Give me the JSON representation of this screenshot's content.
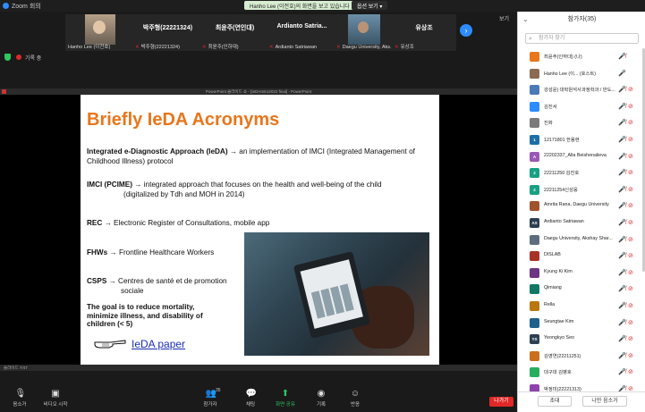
{
  "window": {
    "title": "Zoom 회의"
  },
  "notice": {
    "text": "Hanho Lee (이전호)의 화면을 보고 있습니다",
    "view_options": "옵션 보기"
  },
  "strip": {
    "view_label": "보기",
    "tiles": [
      {
        "big": "",
        "small": "Hanho Lee (이전호)",
        "muted": false,
        "has_cam": "face1"
      },
      {
        "big": "박주형(22221324)",
        "small": "박주형(22221324)",
        "muted": true
      },
      {
        "big": "최윤주(연인대)",
        "small": "최윤주(인하대)",
        "muted": true
      },
      {
        "big": "Ardianto  Satria...",
        "small": "Ardianto Satriawan",
        "muted": true
      },
      {
        "big": "",
        "small": "Daegu University, Aks...",
        "muted": true,
        "has_cam": "face2"
      },
      {
        "big": "유상조",
        "small": "유상조",
        "muted": true
      }
    ]
  },
  "share": {
    "rec_label": "기록 중"
  },
  "ppt": {
    "window_title": "PowerPoint 슬라이드 쇼 - [IeDAIntro2022 final] - PowerPoint",
    "status_text": "슬라이드 7/47",
    "slide": {
      "title": "Briefly IeDA Acronyms",
      "item1_bold": "Integrated e-Diagnostic Approach (IeDA)",
      "item1_rest": "→  an implementation of IMCI (Integrated Management of Childhood Illness) protocol",
      "item2_bold": "IMCI (PCIME)",
      "item2_rest": "→  integrated approach that focuses on the health and well-being of the child",
      "item2_line2": "(digitalized by Tdh and MOH in 2014)",
      "item3_bold": "REC",
      "item3_rest": "→ Electronic Register of Consultations, mobile app",
      "item4_bold": "FHWs",
      "item4_rest": "→ Frontline Healthcare Workers",
      "item5_bold": "CSPS",
      "item5_rest": "→  Centres de santé et de promotion",
      "item5_line2": "sociale",
      "goal": "The goal is to reduce mortality, minimize illness, and disability of children  (< 5)",
      "link": "IeDA paper"
    }
  },
  "toolbar": {
    "mute": "음소거",
    "video": "비디오 시작",
    "participants": "참가자",
    "participants_count": "35",
    "chat": "채팅",
    "share": "화면 공유",
    "record": "기록",
    "reactions": "반응",
    "leave": "나가기"
  },
  "panel": {
    "title": "참가자(35)",
    "search_placeholder": "참가자 찾기",
    "invite": "초대",
    "mute_me": "나만 음소거",
    "participants": [
      {
        "initials": "",
        "color": "#e8761c",
        "name": "최윤주(인하대) (나)",
        "mic": "off",
        "cam": "ok"
      },
      {
        "initials": "",
        "color": "#8b6a52",
        "name": "Hanho Lee (이... (호스트)",
        "mic": "on",
        "cam": "ok"
      },
      {
        "initials": "",
        "color": "#4a7ab8",
        "name": "강성윤| 대학원석사과정학과 / 반도...",
        "mic": "off",
        "cam": "off"
      },
      {
        "initials": "",
        "color": "#2d8cff",
        "name": "김진서",
        "mic": "off",
        "cam": "off"
      },
      {
        "initials": "",
        "color": "#7a7a7a",
        "name": "진화",
        "mic": "off",
        "cam": "off"
      },
      {
        "initials": "1",
        "color": "#1d6fa5",
        "name": "12171801 한용현",
        "mic": "off",
        "cam": "off"
      },
      {
        "initials": "A",
        "color": "#9b59b6",
        "name": "22202337_Alla Beishenalieva",
        "mic": "off",
        "cam": "off"
      },
      {
        "initials": "2",
        "color": "#16a085",
        "name": "22211250 김진호",
        "mic": "off",
        "cam": "off"
      },
      {
        "initials": "2",
        "color": "#16a085",
        "name": "22211254신성웅",
        "mic": "off",
        "cam": "off"
      },
      {
        "initials": "",
        "color": "#a0522d",
        "name": "Amrita Rana, Daegu University",
        "mic": "off",
        "cam": "off"
      },
      {
        "initials": "AS",
        "color": "#2c3e50",
        "name": "Ardianto Satriawan",
        "mic": "off",
        "cam": "off"
      },
      {
        "initials": "",
        "color": "#5d6d7e",
        "name": "Daegu University, Akshay Shar...",
        "mic": "off",
        "cam": "off"
      },
      {
        "initials": "",
        "color": "#a93226",
        "name": "DISLAB",
        "mic": "off",
        "cam": "off"
      },
      {
        "initials": "",
        "color": "#6c3483",
        "name": "Kyung Ki Kim",
        "mic": "off",
        "cam": "off"
      },
      {
        "initials": "",
        "color": "#117864",
        "name": "Qimiang",
        "mic": "off",
        "cam": "off"
      },
      {
        "initials": "",
        "color": "#b9770e",
        "name": "Rella",
        "mic": "off",
        "cam": "off"
      },
      {
        "initials": "",
        "color": "#1f618d",
        "name": "Seungtae Kim",
        "mic": "off",
        "cam": "off"
      },
      {
        "initials": "YS",
        "color": "#2e4053",
        "name": "Yeongkyo Seo",
        "mic": "off",
        "cam": "off"
      },
      {
        "initials": "",
        "color": "#ca6f1e",
        "name": "김영연(22211251)",
        "mic": "off",
        "cam": "off"
      },
      {
        "initials": "",
        "color": "#27ae60",
        "name": "대구대 김병호",
        "mic": "off",
        "cam": "off"
      },
      {
        "initials": "",
        "color": "#8e44ad",
        "name": "박정미(22221313)",
        "mic": "off",
        "cam": "off"
      }
    ]
  }
}
